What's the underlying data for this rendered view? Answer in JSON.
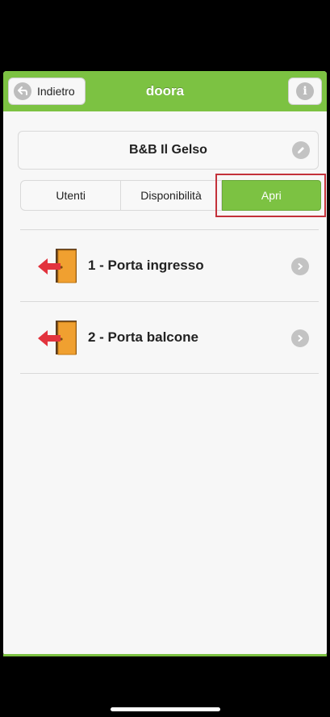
{
  "navbar": {
    "title": "doora",
    "back_label": "Indietro",
    "back_icon": "back-arrow-icon",
    "info_icon": "info-icon",
    "accent_color": "#7cc242"
  },
  "property": {
    "name": "B&B Il Gelso",
    "edit_icon": "pencil-icon"
  },
  "tabs": [
    {
      "label": "Utenti",
      "active": false
    },
    {
      "label": "Disponibilità",
      "active": false
    },
    {
      "label": "Apri",
      "active": true
    }
  ],
  "doors": [
    {
      "label": "1 - Porta ingresso",
      "icon": "door-exit-icon"
    },
    {
      "label": "2 - Porta balcone",
      "icon": "door-exit-icon"
    }
  ],
  "highlight_color": "#c3313a"
}
